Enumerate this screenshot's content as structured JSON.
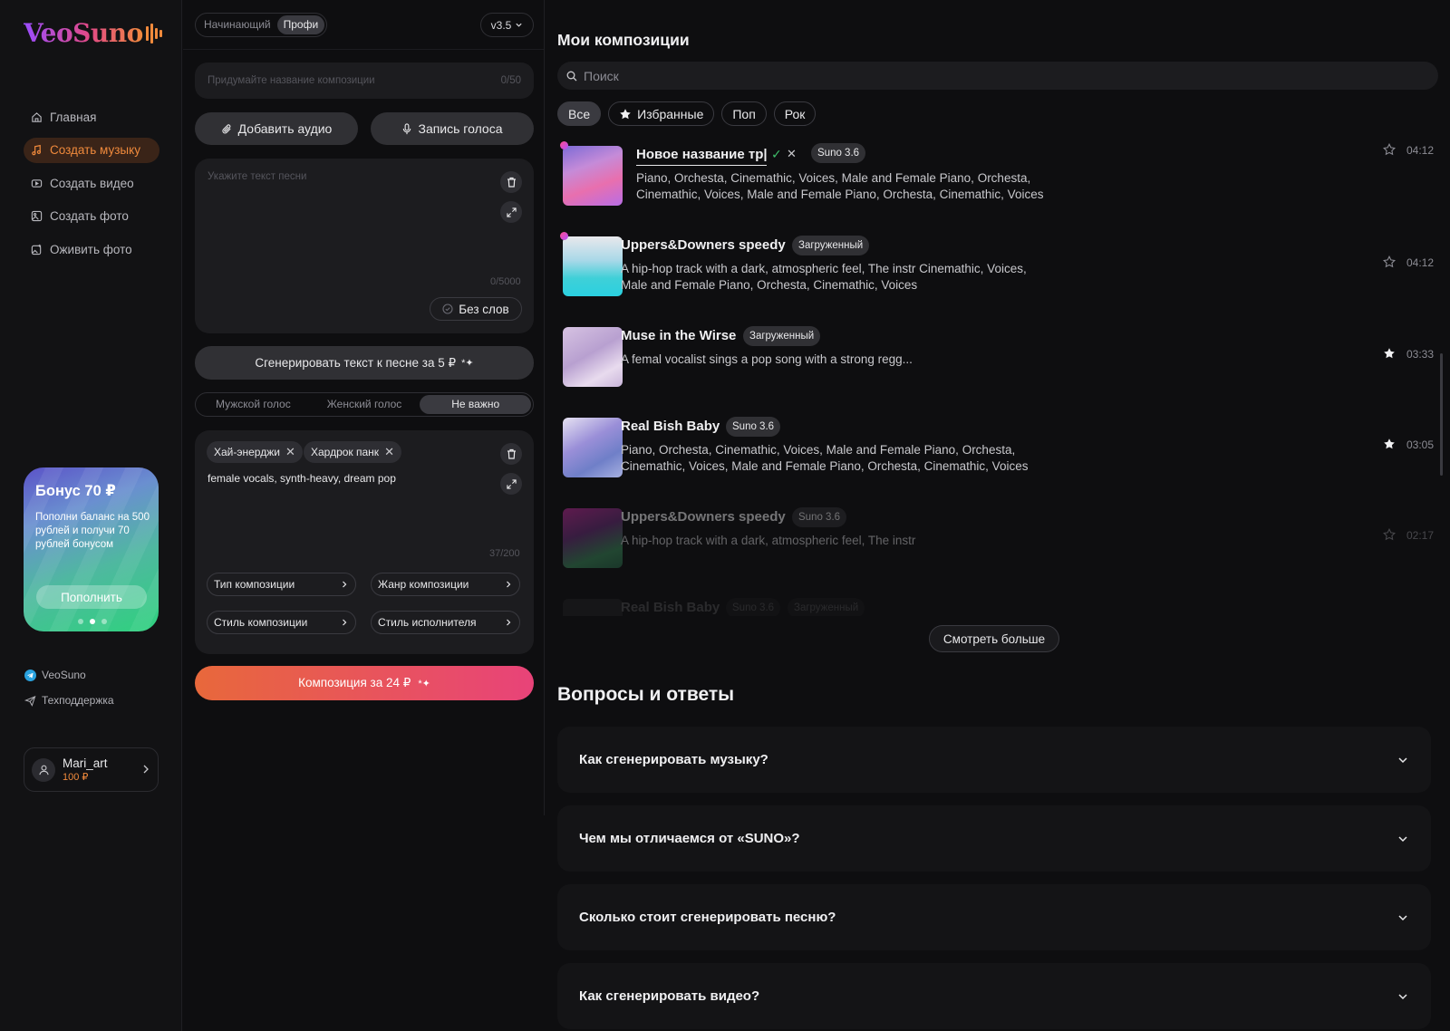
{
  "brand": {
    "name": "VeoSuno"
  },
  "colors": {
    "accent": "#f08a3c",
    "gradient_start": "#e8683b",
    "gradient_end": "#e84379"
  },
  "nav": {
    "items": [
      {
        "label": "Главная",
        "icon": "home-icon",
        "active": false
      },
      {
        "label": "Создать музыку",
        "icon": "music-note-icon",
        "active": true
      },
      {
        "label": "Создать видео",
        "icon": "video-icon",
        "active": false
      },
      {
        "label": "Создать фото",
        "icon": "image-icon",
        "active": false
      },
      {
        "label": "Оживить фото",
        "icon": "animate-photo-icon",
        "active": false
      }
    ]
  },
  "bonus": {
    "title": "Бонус 70 ₽",
    "text": "Пополни баланс на 500 рублей и получи 70 рублей бонусом",
    "button": "Пополнить",
    "slides": 3,
    "active_slide": 2
  },
  "links": {
    "telegram": "VeoSuno",
    "support": "Техподдержка"
  },
  "user": {
    "name": "Mari_art",
    "balance": "100 ₽"
  },
  "editor": {
    "mode_beginner": "Начинающий",
    "mode_pro": "Профи",
    "version": "v3.5",
    "title_placeholder": "Придумайте название композиции",
    "title_counter": "0/50",
    "add_audio": "Добавить аудио",
    "record_voice": "Запись голоса",
    "lyrics_placeholder": "Укажите текст песни",
    "lyrics_counter": "0/5000",
    "no_words": "Без слов",
    "generate_lyrics": "Сгенерировать текст к песне за 5 ₽",
    "voice_male": "Мужской голос",
    "voice_female": "Женский голос",
    "voice_any": "Не важно",
    "tags": [
      "Хай-энерджи",
      "Хардрок панк"
    ],
    "style_text": "female vocals, synth-heavy, dream pop",
    "style_counter": "37/200",
    "select_type": "Тип композиции",
    "select_genre": "Жанр композиции",
    "select_style": "Стиль композиции",
    "select_artist_style": "Стиль исполнителя",
    "compose_button": "Композиция за 24 ₽"
  },
  "compositions": {
    "heading": "Мои композиции",
    "search_placeholder": "Поиск",
    "filters": [
      "Все",
      "Избранные",
      "Поп",
      "Рок"
    ],
    "tracks": [
      {
        "title": "Новое название тр|",
        "badge": "Suno 3.6",
        "desc": "Piano, Orchesta, Cinemathic, Voices, Male and Female Piano, Orchesta, Cinemathic, Voices, Male and Female Piano, Orchesta, Cinemathic, Voices",
        "duration": "04:12",
        "starred": false,
        "editing": true,
        "new": true
      },
      {
        "title": "Uppers&Downers speedy",
        "badge": "Загруженный",
        "desc": "A hip-hop track with a dark, atmospheric feel, The instr Cinemathic, Voices, Male and Female Piano, Orchesta, Cinemathic, Voices",
        "duration": "04:12",
        "starred": false,
        "new": true
      },
      {
        "title": "Muse in the Wirse",
        "badge": "Загруженный",
        "desc": "A femal vocalist sings a pop song with a strong regg...",
        "duration": "03:33",
        "starred": true
      },
      {
        "title": "Real Bish Baby",
        "badge": "Suno 3.6",
        "desc": "Piano, Orchesta, Cinemathic, Voices, Male and Female Piano, Orchesta, Cinemathic, Voices, Male and Female Piano, Orchesta, Cinemathic, Voices",
        "duration": "03:05",
        "starred": true
      },
      {
        "title": "Uppers&Downers speedy",
        "badge": "Suno 3.6",
        "desc": "A hip-hop track with a dark, atmospheric feel, The instr",
        "duration": "02:17",
        "starred": false
      },
      {
        "title": "Real Bish Baby",
        "badges": [
          "Suno 3.6",
          "Загруженный"
        ]
      }
    ],
    "see_more": "Смотреть больше"
  },
  "faq": {
    "heading": "Вопросы и ответы",
    "items": [
      "Как сгенерировать музыку?",
      "Чем мы отличаемся от «SUNO»?",
      "Сколько стоит сгенерировать песню?",
      "Как сгенерировать видео?"
    ]
  }
}
